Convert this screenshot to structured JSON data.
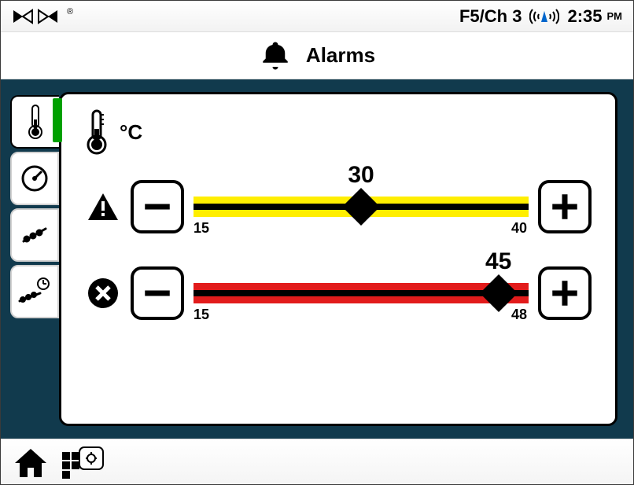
{
  "statusbar": {
    "channel": "F5/Ch 3",
    "time": "2:35",
    "ampm": "PM",
    "brand_mark": "®"
  },
  "title": "Alarms",
  "unit": "°C",
  "warning": {
    "value": "30",
    "min": "15",
    "max": "40",
    "fill_start_pct": 0,
    "fill_end_pct": 100,
    "marker_pct": 50
  },
  "critical": {
    "value": "45",
    "min": "15",
    "max": "48",
    "fill_start_pct": 0,
    "fill_end_pct": 100,
    "marker_pct": 91
  }
}
